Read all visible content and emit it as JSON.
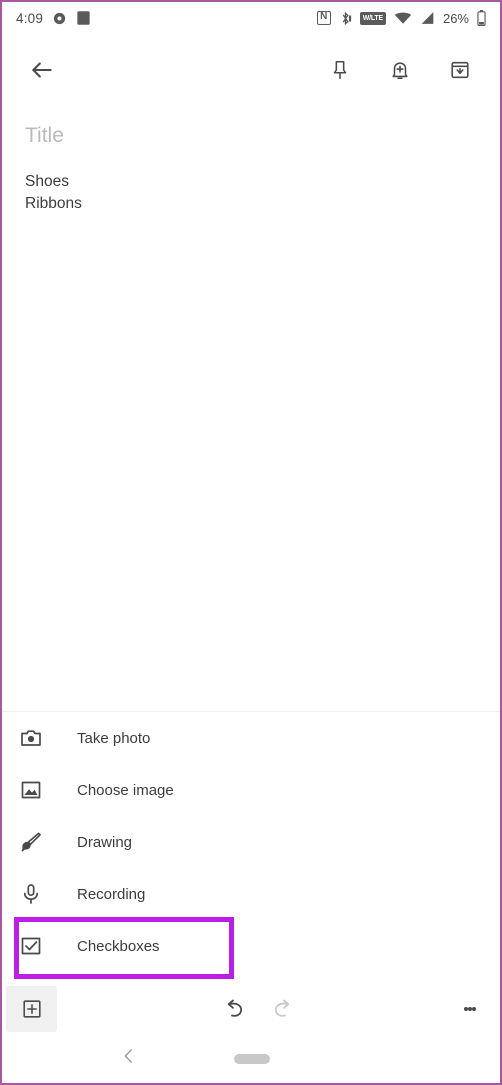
{
  "status_bar": {
    "time": "4:09",
    "battery_percent": "26%",
    "icons": {
      "alarm": "alarm-clock-icon",
      "screenshot": "square-app-icon",
      "nfc": "nfc-icon",
      "nfc_letter": "N",
      "bluetooth": "bluetooth-icon",
      "volte": "VoLTE",
      "volte_label": "W/LTE",
      "wifi": "wifi-icon",
      "signal": "cellular-signal-icon",
      "battery": "battery-icon"
    }
  },
  "toolbar": {
    "back": "back-arrow",
    "pin": "pin",
    "reminder": "add-reminder-bell",
    "archive": "archive"
  },
  "note": {
    "title_placeholder": "Title",
    "title_value": "",
    "body": "Shoes\nRibbons"
  },
  "attachment_menu": {
    "items": [
      {
        "label": "Take photo",
        "icon": "camera-icon"
      },
      {
        "label": "Choose image",
        "icon": "image-icon"
      },
      {
        "label": "Drawing",
        "icon": "brush-icon"
      },
      {
        "label": "Recording",
        "icon": "microphone-icon"
      },
      {
        "label": "Checkboxes",
        "icon": "checkbox-icon"
      }
    ],
    "highlighted_item": "Checkboxes",
    "highlight_color": "#bb1fe6"
  },
  "bottom_bar": {
    "add": "add-box-icon",
    "undo": "undo-icon",
    "redo": "redo-icon",
    "more": "more-options-icon",
    "undo_enabled": true,
    "redo_enabled": false
  },
  "nav_bar": {
    "back": "nav-back-chevron",
    "home": "nav-home-pill"
  },
  "colors": {
    "frame_border": "#a8589f",
    "highlight": "#bb1fe6",
    "icon": "#4a4a4a",
    "text": "#3c3c3c",
    "placeholder": "#b9b9b9",
    "disabled": "#c9c9c9"
  }
}
